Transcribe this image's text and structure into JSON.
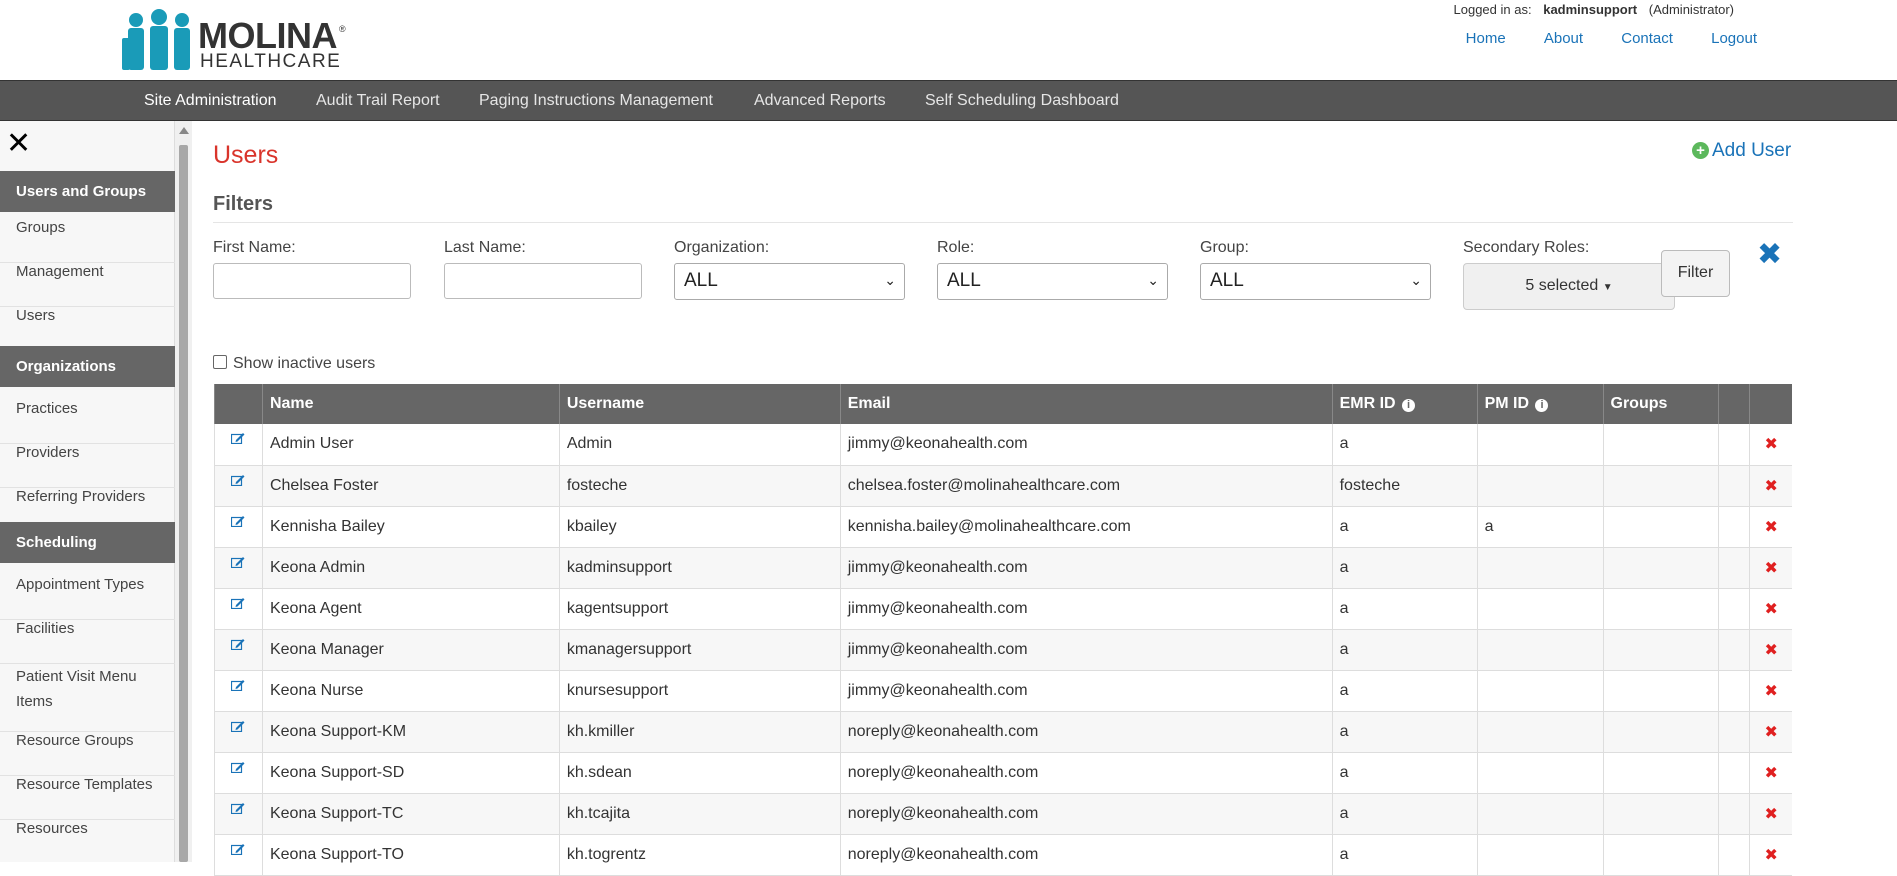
{
  "brand": {
    "name": "MOLINA",
    "sub": "HEALTHCARE",
    "reg": "®",
    "color": "#1a9bb8"
  },
  "login": {
    "prefix": "Logged in as:",
    "user": "kadminsupport",
    "role": "(Administrator)"
  },
  "top_links": [
    "Home",
    "About",
    "Contact",
    "Logout"
  ],
  "nav": [
    "Site Administration",
    "Audit Trail Report",
    "Paging Instructions Management",
    "Advanced Reports",
    "Self Scheduling Dashboard"
  ],
  "sidebar": {
    "sections": [
      {
        "title": "Users and Groups",
        "items": [
          "Groups",
          "Management",
          "Users"
        ]
      },
      {
        "title": "Organizations",
        "items": [
          "Practices",
          "Providers",
          "Referring Providers"
        ]
      },
      {
        "title": "Scheduling",
        "items": [
          "Appointment Types",
          "Facilities",
          "Patient Visit Menu Items",
          "Resource Groups",
          "Resource Templates",
          "Resources"
        ]
      }
    ]
  },
  "page": {
    "title": "Users",
    "add_user": "Add User",
    "filters_title": "Filters"
  },
  "filters": {
    "first_name": "First Name:",
    "last_name": "Last Name:",
    "organization": {
      "label": "Organization:",
      "value": "ALL"
    },
    "role": {
      "label": "Role:",
      "value": "ALL"
    },
    "group": {
      "label": "Group:",
      "value": "ALL"
    },
    "secondary_roles": {
      "label": "Secondary Roles:",
      "value": "5 selected"
    },
    "filter_button": "Filter",
    "show_inactive": "Show inactive users"
  },
  "table": {
    "columns": [
      "Name",
      "Username",
      "Email",
      "EMR ID",
      "PM ID",
      "Groups"
    ],
    "rows": [
      {
        "name": "Admin User",
        "username": "Admin",
        "email": "jimmy@keonahealth.com",
        "emr": "a",
        "pm": ""
      },
      {
        "name": "Chelsea Foster",
        "username": "fosteche",
        "email": "chelsea.foster@molinahealthcare.com",
        "emr": "fosteche",
        "pm": ""
      },
      {
        "name": "Kennisha Bailey",
        "username": "kbailey",
        "email": "kennisha.bailey@molinahealthcare.com",
        "emr": "a",
        "pm": "a"
      },
      {
        "name": "Keona Admin",
        "username": "kadminsupport",
        "email": "jimmy@keonahealth.com",
        "emr": "a",
        "pm": ""
      },
      {
        "name": "Keona Agent",
        "username": "kagentsupport",
        "email": "jimmy@keonahealth.com",
        "emr": "a",
        "pm": ""
      },
      {
        "name": "Keona Manager",
        "username": "kmanagersupport",
        "email": "jimmy@keonahealth.com",
        "emr": "a",
        "pm": ""
      },
      {
        "name": "Keona Nurse",
        "username": "knursesupport",
        "email": "jimmy@keonahealth.com",
        "emr": "a",
        "pm": ""
      },
      {
        "name": "Keona Support-KM",
        "username": "kh.kmiller",
        "email": "noreply@keonahealth.com",
        "emr": "a",
        "pm": ""
      },
      {
        "name": "Keona Support-SD",
        "username": "kh.sdean",
        "email": "noreply@keonahealth.com",
        "emr": "a",
        "pm": ""
      },
      {
        "name": "Keona Support-TC",
        "username": "kh.tcajita",
        "email": "noreply@keonahealth.com",
        "emr": "a",
        "pm": ""
      },
      {
        "name": "Keona Support-TO",
        "username": "kh.togrentz",
        "email": "noreply@keonahealth.com",
        "emr": "a",
        "pm": ""
      }
    ]
  }
}
